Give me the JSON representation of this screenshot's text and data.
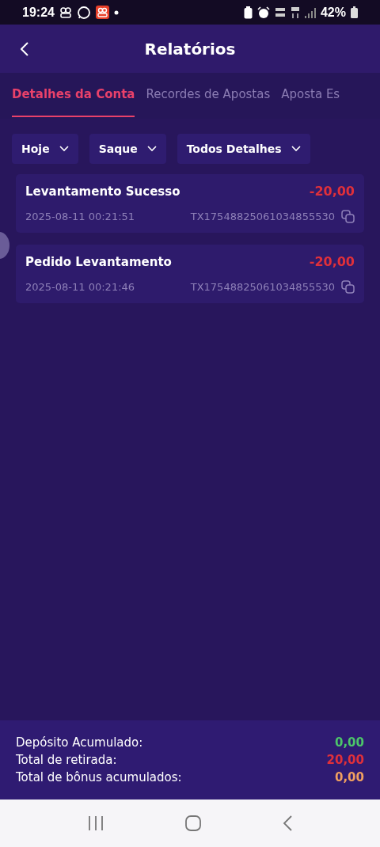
{
  "status_bar": {
    "time": "19:24",
    "battery": "42%"
  },
  "header": {
    "title": "Relatórios"
  },
  "tabs": [
    {
      "label": "Detalhes da Conta",
      "selected": true
    },
    {
      "label": "Recordes de Apostas",
      "selected": false
    },
    {
      "label": "Aposta Es",
      "selected": false
    }
  ],
  "filters": [
    {
      "label": "Hoje"
    },
    {
      "label": "Saque"
    },
    {
      "label": "Todos Detalhes"
    }
  ],
  "transactions": [
    {
      "title": "Levantamento Sucesso",
      "amount": "-20,00",
      "date": "2025-08-11 00:21:51",
      "id": "TX17548825061034855530"
    },
    {
      "title": "Pedido Levantamento",
      "amount": "-20,00",
      "date": "2025-08-11 00:21:46",
      "id": "TX17548825061034855530"
    }
  ],
  "summary": [
    {
      "label": "Depósito Acumulado:",
      "value": "0,00",
      "color": "#4cc66a"
    },
    {
      "label": "Total de retirada:",
      "value": "20,00",
      "color": "#e0303a"
    },
    {
      "label": "Total de bônus acumulados:",
      "value": "0,00",
      "color": "#f0a060"
    }
  ]
}
